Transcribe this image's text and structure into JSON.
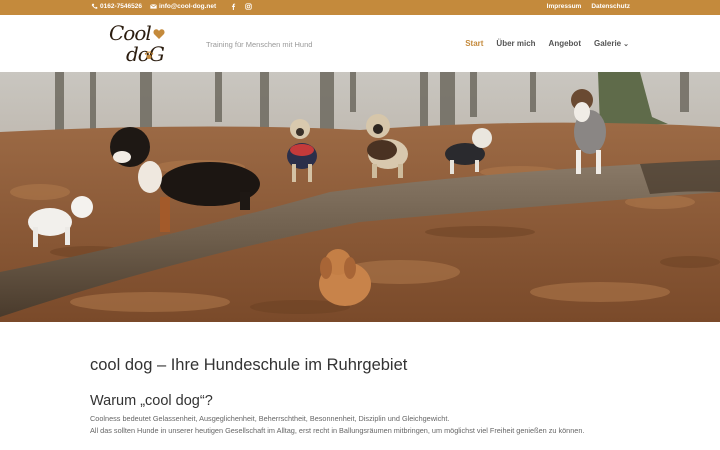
{
  "topbar": {
    "phone": "0162-7546526",
    "email": "info@cool-dog.net",
    "links": [
      "Impressum",
      "Datenschutz"
    ],
    "icons": [
      "phone-icon",
      "mail-icon",
      "facebook-icon",
      "instagram-icon"
    ]
  },
  "header": {
    "logo_line1": "Cool",
    "logo_line2": "doG",
    "tagline": "Training für Menschen mit Hund",
    "nav": [
      {
        "label": "Start"
      },
      {
        "label": "Über mich"
      },
      {
        "label": "Angebot"
      },
      {
        "label": "Galerie"
      }
    ]
  },
  "main": {
    "title": "cool dog – Ihre Hundeschule im Ruhrgebiet",
    "subtitle": "Warum „cool dog“?",
    "para1": "Coolness bedeutet Gelassenheit, Ausgeglichenheit, Beherrschtheit, Besonnenheit, Disziplin und Gleichgewicht.",
    "para2": "All das sollten Hunde in unserer heutigen Gesellschaft im Alltag, erst recht in Ballungsräumen mitbringen, um möglichst viel Freiheit genießen zu können."
  },
  "colors": {
    "accent": "#c48a3c",
    "text_dark": "#333333",
    "text_body": "#666666"
  }
}
